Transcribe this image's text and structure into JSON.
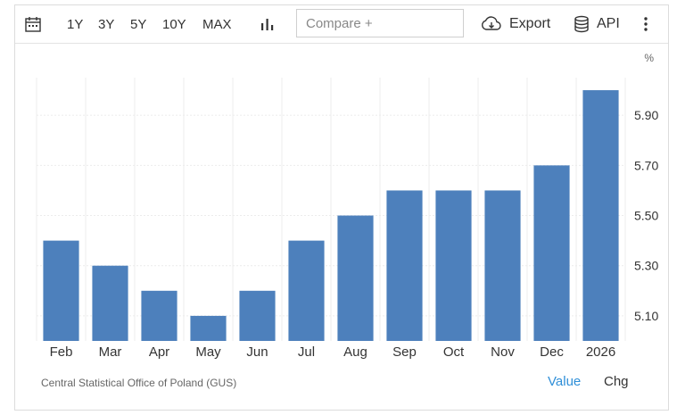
{
  "toolbar": {
    "ranges": [
      "1Y",
      "3Y",
      "5Y",
      "10Y",
      "MAX"
    ],
    "compare_placeholder": "Compare +",
    "export_label": "Export",
    "api_label": "API"
  },
  "chart_data": {
    "type": "bar",
    "unit": "%",
    "categories": [
      "Feb",
      "Mar",
      "Apr",
      "May",
      "Jun",
      "Jul",
      "Aug",
      "Sep",
      "Oct",
      "Nov",
      "Dec",
      "2026"
    ],
    "values": [
      5.4,
      5.3,
      5.2,
      5.1,
      5.2,
      5.4,
      5.5,
      5.6,
      5.6,
      5.6,
      5.7,
      6.0
    ],
    "yticks": [
      "5.10",
      "5.30",
      "5.50",
      "5.70",
      "5.90"
    ],
    "ylim": [
      5.0,
      6.05
    ],
    "bar_color": "#4d80bc",
    "grid": true
  },
  "footer": {
    "source": "Central Statistical Office of Poland (GUS)",
    "value_label": "Value",
    "chg_label": "Chg"
  },
  "colors": {
    "accent": "#2f8fd8",
    "bar": "#4d80bc"
  }
}
